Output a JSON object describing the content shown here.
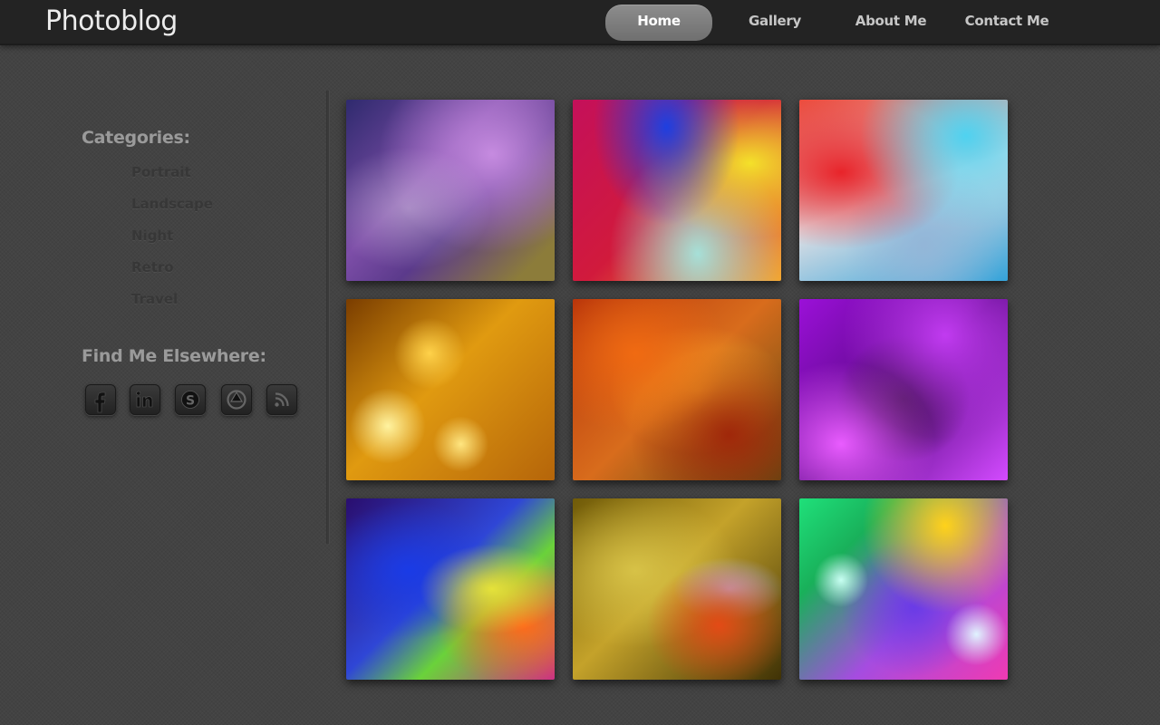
{
  "site": {
    "brand": "Photoblog"
  },
  "nav": {
    "items": [
      {
        "label": "Home",
        "active": true
      },
      {
        "label": "Gallery",
        "active": false
      },
      {
        "label": "About Me",
        "active": false
      },
      {
        "label": "Contact Me",
        "active": false
      }
    ]
  },
  "sidebar": {
    "categories_heading": "Categories:",
    "categories": [
      "Portrait",
      "Landscape",
      "Night",
      "Retro",
      "Travel"
    ],
    "social_heading": "Find Me Elsewhere:",
    "social": [
      {
        "icon": "facebook-icon"
      },
      {
        "icon": "linkedin-icon"
      },
      {
        "icon": "skype-icon"
      },
      {
        "icon": "picasa-icon"
      },
      {
        "icon": "rss-icon"
      }
    ]
  },
  "gallery": {
    "photos": [
      {
        "description": "abstract purple and violet streaks"
      },
      {
        "description": "blurred red, blue and yellow color field"
      },
      {
        "description": "red and cyan paint strokes"
      },
      {
        "description": "golden bokeh lights"
      },
      {
        "description": "orange and red textured abstract"
      },
      {
        "description": "purple and magenta crystalline abstract"
      },
      {
        "description": "blue, green and orange polygon abstract"
      },
      {
        "description": "golden oil bubbles on water"
      },
      {
        "description": "colorful blurred bokeh lights"
      }
    ]
  },
  "colors": {
    "background": "#434343",
    "topbar": "#232323",
    "nav_active": "#7f7f7f",
    "heading_text": "#9a9a9a",
    "category_text": "#373737"
  }
}
